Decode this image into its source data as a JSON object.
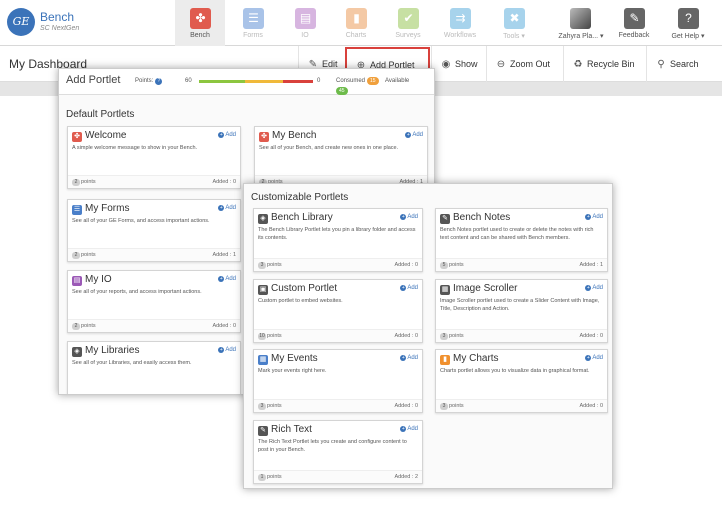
{
  "app": {
    "logo_text": "GE",
    "name": "Bench",
    "subtitle": "SC NextGen"
  },
  "nav": [
    {
      "label": "Bench",
      "icon": "share-icon",
      "glyph": "✤",
      "color": "#e05b4e",
      "active": true
    },
    {
      "label": "Forms",
      "icon": "forms-icon",
      "glyph": "☰",
      "color": "#a9c3e8"
    },
    {
      "label": "IO",
      "icon": "io-icon",
      "glyph": "▤",
      "color": "#d7b5e0"
    },
    {
      "label": "Charts",
      "icon": "charts-icon",
      "glyph": "▮",
      "color": "#f4c9a5"
    },
    {
      "label": "Surveys",
      "icon": "surveys-icon",
      "glyph": "✔",
      "color": "#c7e0a3"
    },
    {
      "label": "Workflows",
      "icon": "workflows-icon",
      "glyph": "⇉",
      "color": "#a7d3ec"
    },
    {
      "label": "Tools ▾",
      "icon": "tools-icon",
      "glyph": "✖",
      "color": "#a7d3ec"
    },
    {
      "label": "Zahyra Pla... ▾",
      "icon": "user-avatar",
      "glyph": "",
      "color": "#777777"
    },
    {
      "label": "Feedback",
      "icon": "feedback-icon",
      "glyph": "✎",
      "color": "#666666"
    },
    {
      "label": "Get Help ▾",
      "icon": "help-icon",
      "glyph": "?",
      "color": "#666666"
    }
  ],
  "toolbar": {
    "title": "My Dashboard",
    "edit": "Edit",
    "add_portlet": "Add Portlet",
    "show": "Show",
    "zoom_out": "Zoom Out",
    "recycle_bin": "Recycle Bin",
    "search": "Search"
  },
  "add_portlet": {
    "title": "Add Portlet",
    "points_label": "Points:",
    "points_help": "?",
    "scale_min": "60",
    "scale_max": "0",
    "consumed_label": "Consumed",
    "consumed_value": "15",
    "available_label": "Available",
    "available_value": "45",
    "colors": {
      "green": "#8cc63f",
      "yellow": "#f0b93a",
      "red": "#d9413c"
    }
  },
  "default_section": {
    "title": "Default Portlets",
    "cards": [
      {
        "title": "Welcome",
        "icon": "share-icon",
        "color": "#e05b4e",
        "desc": "A simple welcome message to show in your Bench.",
        "points": "2",
        "points_label": "points",
        "added": "Added : 0",
        "add": "Add"
      },
      {
        "title": "My Bench",
        "icon": "share-icon",
        "color": "#e05b4e",
        "desc": "See all of your Bench, and create new ones in one place.",
        "points": "2",
        "points_label": "points",
        "added": "Added : 1",
        "add": "Add"
      },
      {
        "title": "My Forms",
        "icon": "forms-icon",
        "color": "#4a7fc9",
        "desc": "See all of your GE Forms, and access important actions.",
        "points": "2",
        "points_label": "points",
        "added": "Added : 1",
        "add": "Add"
      },
      {
        "title": "My IO",
        "icon": "io-icon",
        "color": "#9b59b6",
        "desc": "See all of your reports, and access important actions.",
        "points": "2",
        "points_label": "points",
        "added": "Added : 0",
        "add": "Add"
      },
      {
        "title": "My Libraries",
        "icon": "library-icon",
        "color": "#555555",
        "desc": "See all of your Libraries, and easily access them.",
        "add": "Add"
      }
    ]
  },
  "custom_section": {
    "title": "Customizable Portlets",
    "cards": [
      {
        "title": "Bench Library",
        "icon": "library-icon",
        "color": "#555555",
        "desc": "The Bench Library Portlet lets you pin a library folder and access its contents.",
        "points": "3",
        "points_label": "points",
        "added": "Added : 0",
        "add": "Add"
      },
      {
        "title": "Bench Notes",
        "icon": "notes-icon",
        "color": "#555555",
        "desc": "Bench Notes portlet used to create or delete the notes with rich text content and can be shared with Bench members.",
        "points": "5",
        "points_label": "points",
        "added": "Added : 1",
        "add": "Add"
      },
      {
        "title": "Custom Portlet",
        "icon": "custom-portlet-icon",
        "color": "#555555",
        "desc": "Custom portlet to embed websites.",
        "points": "10",
        "points_label": "points",
        "added": "Added : 0",
        "add": "Add"
      },
      {
        "title": "Image Scroller",
        "icon": "image-icon",
        "color": "#555555",
        "desc": "Image Scroller portlet used to create a Slider Content with Image, Title, Description and Action.",
        "points": "3",
        "points_label": "points",
        "added": "Added : 0",
        "add": "Add"
      },
      {
        "title": "My Events",
        "icon": "events-icon",
        "color": "#4a7fc9",
        "desc": "Mark your events right here.",
        "points": "3",
        "points_label": "points",
        "added": "Added : 0",
        "add": "Add"
      },
      {
        "title": "My Charts",
        "icon": "charts-icon",
        "color": "#f0902e",
        "desc": "Charts portlet allows you to visualize data in graphical format.",
        "points": "3",
        "points_label": "points",
        "added": "Added : 0",
        "add": "Add"
      },
      {
        "title": "Rich Text",
        "icon": "rich-text-icon",
        "color": "#555555",
        "desc": "The Rich Text Portlet lets you create and configure content to post in your Bench.",
        "points": "1",
        "points_label": "points",
        "added": "Added : 2",
        "add": "Add"
      }
    ]
  }
}
